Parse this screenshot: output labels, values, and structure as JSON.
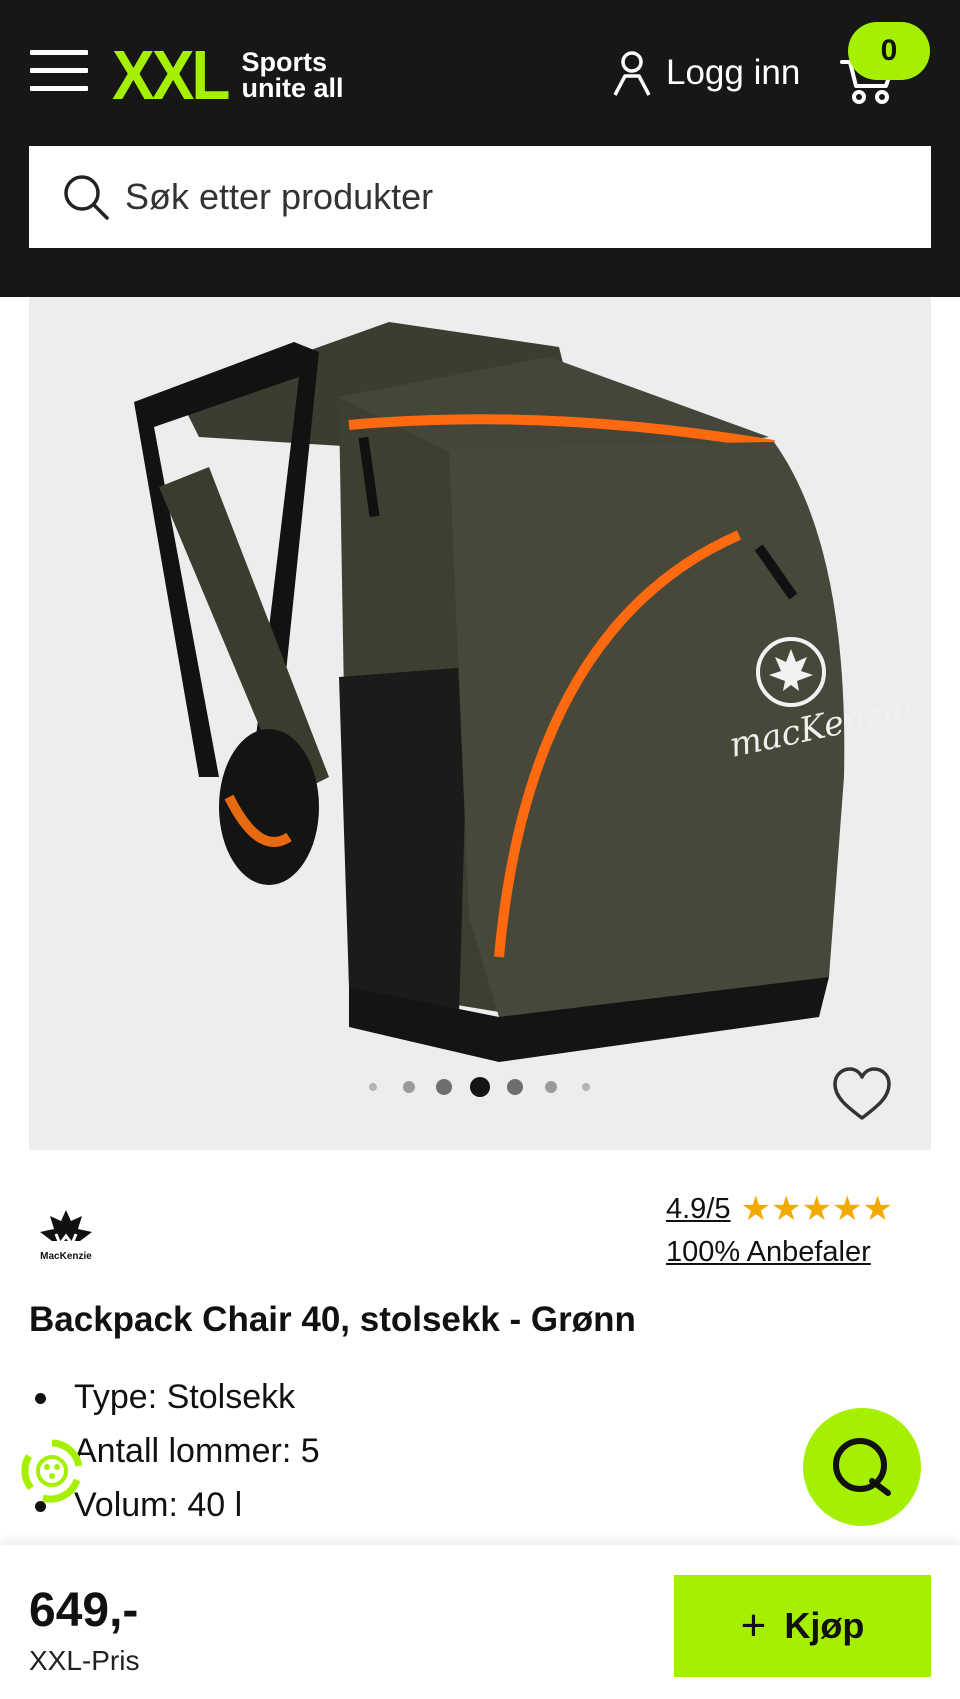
{
  "header": {
    "menu_icon": "hamburger-icon",
    "logo": {
      "mark": "XXL",
      "tagline_line1": "Sports",
      "tagline_line2": "unite all"
    },
    "login_label": "Logg inn",
    "login_icon": "user-icon",
    "cart_icon": "cart-icon",
    "cart_count": "0",
    "search_placeholder": "Søk etter produkter",
    "search_icon": "search-icon"
  },
  "gallery": {
    "image": "backpack-chair-product-photo",
    "slide_count": 7,
    "active_slide": 4,
    "favorite_icon": "heart-icon"
  },
  "product": {
    "brand": "MacKenzie",
    "rating": "4.9/5",
    "stars": "★★★★★",
    "recommend": "100% Anbefaler",
    "title": "Backpack Chair 40, stolsekk - Grønn",
    "features": [
      "Type: Stolsekk",
      "Antall lommer: 5",
      "Volum: 40 l"
    ]
  },
  "footer": {
    "price": "649,-",
    "price_label": "XXL-Pris",
    "buy_plus": "+",
    "buy_label": "Kjøp"
  },
  "colors": {
    "accent": "#a4f000",
    "header_bg": "#171717",
    "star": "#f2a900",
    "gallery_bg": "#ededee"
  }
}
